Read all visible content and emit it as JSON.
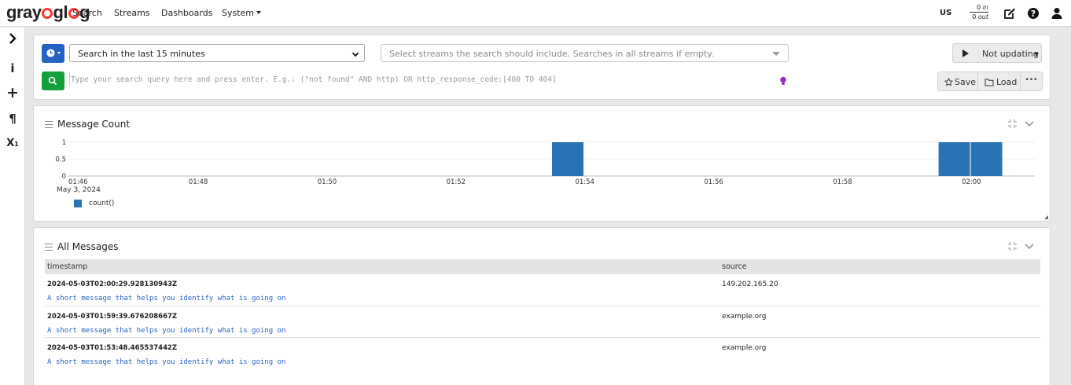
{
  "brand": {
    "name_prefix": "gray",
    "name_o": "o",
    "name_suffix": "g",
    "name_l": "l",
    "accent": "#ff3633"
  },
  "nav": {
    "search": "Search",
    "streams": "Streams",
    "dashboards": "Dashboards",
    "system": "System"
  },
  "header": {
    "timezone": "US",
    "throughput_in_value": "0",
    "throughput_in_unit": "in",
    "throughput_out_value": "0",
    "throughput_out_unit": "out"
  },
  "icons": {
    "edit": "edit-icon",
    "help": "help-icon",
    "user": "user-icon"
  },
  "search": {
    "time_range": "Search in the last 15 minutes",
    "streams_placeholder": "Select streams the search should include. Searches in all streams if empty.",
    "refresh_label": "Not updating",
    "query_placeholder": "Type your search query here and press enter. E.g.: (\"not found\" AND http) OR http_response_code:[400 TO 404]",
    "save_label": "Save",
    "load_label": "Load",
    "more_label": "•••"
  },
  "message_count": {
    "title": "Message Count",
    "legend_label": "count()",
    "x_date_label": "May 3, 2024"
  },
  "chart_data": {
    "type": "bar",
    "title": "Message Count",
    "x_ticks": [
      "01:46",
      "01:48",
      "01:50",
      "01:52",
      "01:54",
      "01:56",
      "01:58",
      "02:00"
    ],
    "y_ticks": [
      "0",
      "0.5",
      "1"
    ],
    "ylim": [
      0,
      1
    ],
    "xlim": [
      "01:46",
      "02:01"
    ],
    "series": [
      {
        "name": "count()",
        "color": "#2873b3",
        "points": [
          {
            "start": "01:53:30",
            "end": "01:54:00",
            "value": 1
          },
          {
            "start": "01:59:30",
            "end": "02:00:00",
            "value": 1
          },
          {
            "start": "02:00:00",
            "end": "02:00:30",
            "value": 1
          }
        ]
      }
    ]
  },
  "all_messages": {
    "title": "All Messages",
    "columns": [
      "timestamp",
      "source"
    ],
    "rows": [
      {
        "timestamp": "2024-05-03T02:00:29.928130943Z",
        "source": "149.202.165.20",
        "message": "A short message that helps you identify what is going on"
      },
      {
        "timestamp": "2024-05-03T01:59:39.676208667Z",
        "source": "example.org",
        "message": "A short message that helps you identify what is going on"
      },
      {
        "timestamp": "2024-05-03T01:53:48.465537442Z",
        "source": "example.org",
        "message": "A short message that helps you identify what is going on"
      }
    ]
  }
}
